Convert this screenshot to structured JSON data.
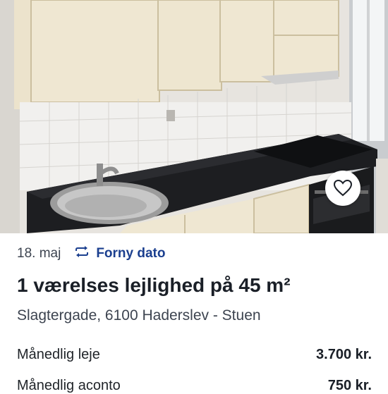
{
  "listing": {
    "date": "18. maj",
    "renew_label": "Forny dato",
    "title": "1 værelses lejlighed på 45 m²",
    "address": "Slagtergade, 6100 Haderslev - Stuen",
    "details": [
      {
        "label": "Månedlig leje",
        "value": "3.700 kr."
      },
      {
        "label": "Månedlig aconto",
        "value": "750 kr."
      }
    ]
  },
  "icons": {
    "favorite": "heart-icon",
    "renew": "repeat-icon"
  },
  "colors": {
    "accent": "#1b3f8f",
    "text": "#1a1f27",
    "muted": "#3d4450"
  }
}
